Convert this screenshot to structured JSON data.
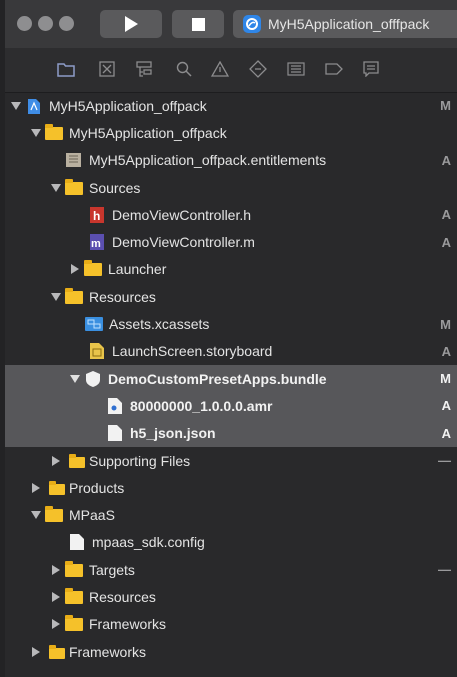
{
  "toolbar": {
    "scheme_label": "MyH5Application_offfpack"
  },
  "navigator": {
    "icons": [
      "folder-icon",
      "source-control-icon",
      "symbol-icon",
      "find-icon",
      "issue-icon",
      "test-icon",
      "debug-icon",
      "breakpoint-icon",
      "report-icon"
    ]
  },
  "tree": {
    "project": {
      "name": "MyH5Application_offpack",
      "status": "M"
    },
    "group_app": {
      "name": "MyH5Application_offpack"
    },
    "entitlements": {
      "name": "MyH5Application_offpack.entitlements",
      "status": "A"
    },
    "sources": {
      "name": "Sources"
    },
    "demo_h": {
      "name": "DemoViewController.h",
      "status": "A"
    },
    "demo_m": {
      "name": "DemoViewController.m",
      "status": "A"
    },
    "launcher": {
      "name": "Launcher"
    },
    "resources": {
      "name": "Resources"
    },
    "assets": {
      "name": "Assets.xcassets",
      "status": "M"
    },
    "launchscreen": {
      "name": "LaunchScreen.storyboard",
      "status": "A"
    },
    "bundle": {
      "name": "DemoCustomPresetApps.bundle",
      "status": "M"
    },
    "amr": {
      "name": "80000000_1.0.0.0.amr",
      "status": "A"
    },
    "json": {
      "name": "h5_json.json",
      "status": "A"
    },
    "supporting": {
      "name": "Supporting Files",
      "status": "—"
    },
    "products": {
      "name": "Products"
    },
    "mpaas": {
      "name": "MPaaS"
    },
    "sdkconfig": {
      "name": "mpaas_sdk.config"
    },
    "targets": {
      "name": "Targets",
      "status": "—"
    },
    "resources2": {
      "name": "Resources"
    },
    "frameworks_inner": {
      "name": "Frameworks"
    },
    "frameworks": {
      "name": "Frameworks"
    }
  },
  "colors": {
    "background": "#29292b",
    "selection": "#57575a",
    "folder": "#f5c12a",
    "accent": "#2f86e8"
  }
}
